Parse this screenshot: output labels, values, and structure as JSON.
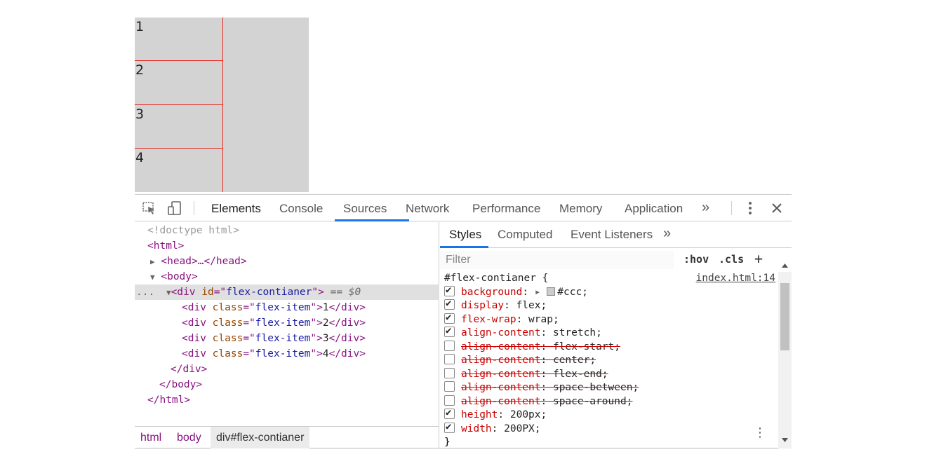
{
  "demo": {
    "items": [
      "1",
      "2",
      "3",
      "4"
    ]
  },
  "toolbar": {
    "tabs": [
      "Elements",
      "Console",
      "Sources",
      "Network",
      "Performance",
      "Memory",
      "Application"
    ],
    "more": "»",
    "active": "Elements"
  },
  "dom": {
    "doctype": "<!doctype html>",
    "html_open": "<html>",
    "head": "<head>…</head>",
    "body_open": "<body>",
    "div_tag": "div",
    "div_id_attr": "id",
    "div_id_val": "flex-contianer",
    "selected_suffix": " == $0",
    "child_class_attr": "class",
    "child_class_val": "flex-item",
    "children": [
      "1",
      "2",
      "3",
      "4"
    ],
    "div_close": "</div>",
    "body_close": "</body>",
    "html_close": "</html>",
    "ellipsis": "..."
  },
  "breadcrumb": [
    "html",
    "body",
    "div#flex-contianer"
  ],
  "styles": {
    "tabs": [
      "Styles",
      "Computed",
      "Event Listeners"
    ],
    "more": "»",
    "filter_placeholder": "Filter",
    "hov": ":hov",
    ".cls": ".cls",
    "plus": "+",
    "selector": "#flex-contianer {",
    "source": "index.html:14",
    "close_brace": "}",
    "properties": [
      {
        "name": "background",
        "value": "#ccc;",
        "checked": true,
        "struck": false
      },
      {
        "name": "display",
        "value": "flex;",
        "checked": true,
        "struck": false
      },
      {
        "name": "flex-wrap",
        "value": "wrap;",
        "checked": true,
        "struck": false
      },
      {
        "name": "align-content",
        "value": "stretch;",
        "checked": true,
        "struck": false
      },
      {
        "name": "align-content",
        "value": "flex-start;",
        "checked": false,
        "struck": true
      },
      {
        "name": "align-content",
        "value": "center;",
        "checked": false,
        "struck": true
      },
      {
        "name": "align-content",
        "value": "flex-end;",
        "checked": false,
        "struck": true
      },
      {
        "name": "align-content",
        "value": "space-between;",
        "checked": false,
        "struck": true
      },
      {
        "name": "align-content",
        "value": "space-around;",
        "checked": false,
        "struck": true
      },
      {
        "name": "height",
        "value": "200px;",
        "checked": true,
        "struck": false
      },
      {
        "name": "width",
        "value": "200PX;",
        "checked": true,
        "struck": false
      }
    ]
  },
  "colors": {
    "accent": "#1a73e8",
    "item_border": "#e8271d",
    "container_bg": "#d3d3d3"
  }
}
